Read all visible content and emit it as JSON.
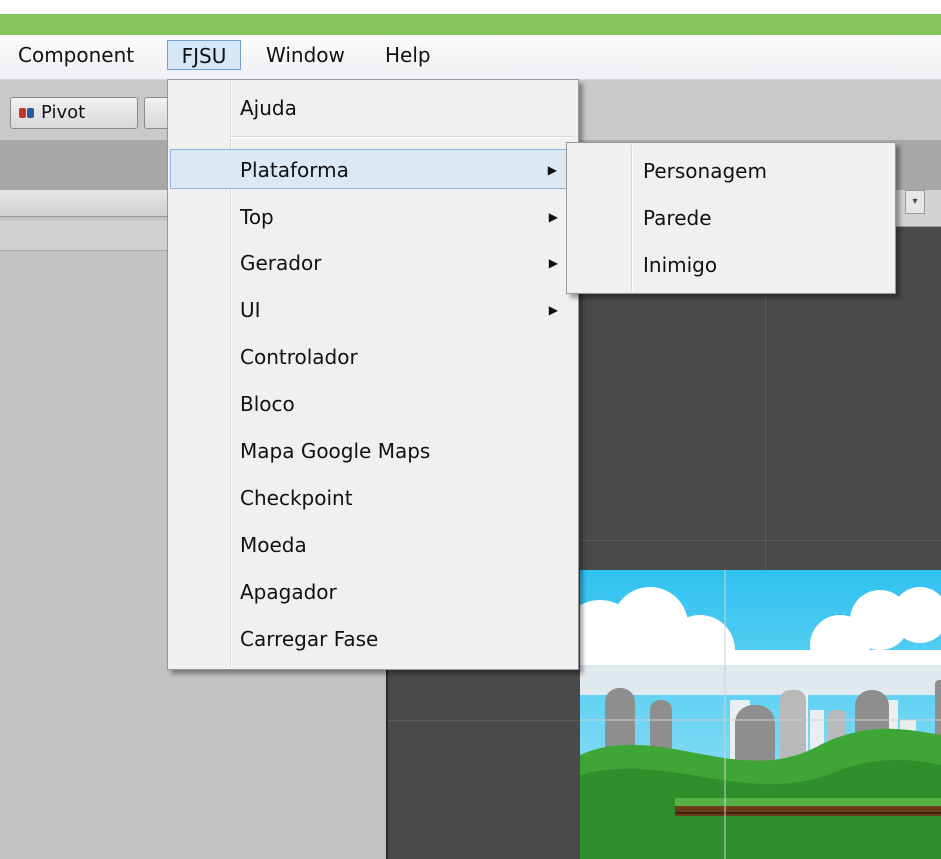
{
  "menubar": {
    "items": [
      "Component",
      "FJSU",
      "Window",
      "Help"
    ],
    "active": "FJSU"
  },
  "toolbar": {
    "pivot_label": "Pivot"
  },
  "fjsu_menu": {
    "items": [
      {
        "label": "Ajuda",
        "submenu": false
      },
      {
        "label": "Plataforma",
        "submenu": true,
        "highlighted": true
      },
      {
        "label": "Top",
        "submenu": true
      },
      {
        "label": "Gerador",
        "submenu": true
      },
      {
        "label": "UI",
        "submenu": true
      },
      {
        "label": "Controlador",
        "submenu": false
      },
      {
        "label": "Bloco",
        "submenu": false
      },
      {
        "label": "Mapa Google Maps",
        "submenu": false
      },
      {
        "label": "Checkpoint",
        "submenu": false
      },
      {
        "label": "Moeda",
        "submenu": false
      },
      {
        "label": "Apagador",
        "submenu": false
      },
      {
        "label": "Carregar Fase",
        "submenu": false
      }
    ]
  },
  "plataforma_submenu": {
    "items": [
      "Personagem",
      "Parede",
      "Inimigo"
    ]
  },
  "colors": {
    "accent_green": "#86c65a",
    "highlight": "#dde8f5",
    "scene_bg": "#4a4a4a"
  },
  "icons": {
    "submenu_arrow": "triangle-right-icon",
    "pivot": "pivot-icon"
  }
}
